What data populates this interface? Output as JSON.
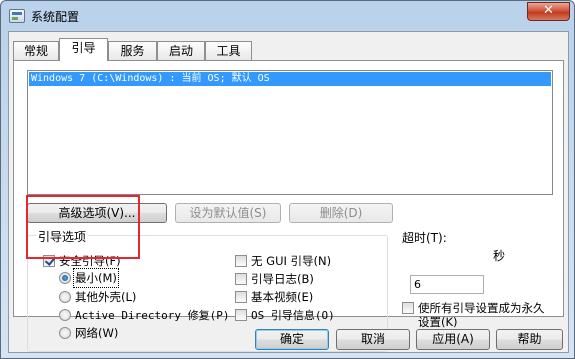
{
  "window": {
    "title": "系统配置",
    "close_glyph": "✕"
  },
  "tabs": [
    "常规",
    "引导",
    "服务",
    "启动",
    "工具"
  ],
  "active_tab": "引导",
  "os_list": {
    "items": [
      "Windows 7 (C:\\Windows) : 当前 OS; 默认 OS"
    ],
    "selected": 0
  },
  "boot_buttons": {
    "advanced": "高级选项(V)...",
    "set_default": "设为默认值(S)",
    "delete": "删除(D)"
  },
  "boot_options": {
    "group_label": "引导选项",
    "safe_boot": {
      "label": "安全引导(F)",
      "checked": true
    },
    "safe_boot_modes": [
      {
        "label": "最小(M)",
        "checked": true
      },
      {
        "label": "其他外壳(L)",
        "checked": false
      },
      {
        "label": "Active Directory 修复(P)",
        "checked": false
      },
      {
        "label": "网络(W)",
        "checked": false
      }
    ],
    "no_gui_boot": {
      "label": "无 GUI 引导(N)",
      "checked": false
    },
    "boot_log": {
      "label": "引导日志(B)",
      "checked": false
    },
    "base_video": {
      "label": "基本视频(E)",
      "checked": false
    },
    "os_boot_info": {
      "label": "OS 引导信息(O)",
      "checked": false
    }
  },
  "timeout": {
    "label": "超时(T):",
    "value": "6",
    "unit": "秒"
  },
  "make_permanent": {
    "label_line1": "使所有引导设置成为永久",
    "label_line2": "设置(K)",
    "checked": false
  },
  "dialog_buttons": {
    "ok": "确定",
    "cancel": "取消",
    "apply": "应用(A)",
    "help": "帮助"
  },
  "colors": {
    "selection": "#3399ff",
    "annotation_box": "#e8262b"
  }
}
